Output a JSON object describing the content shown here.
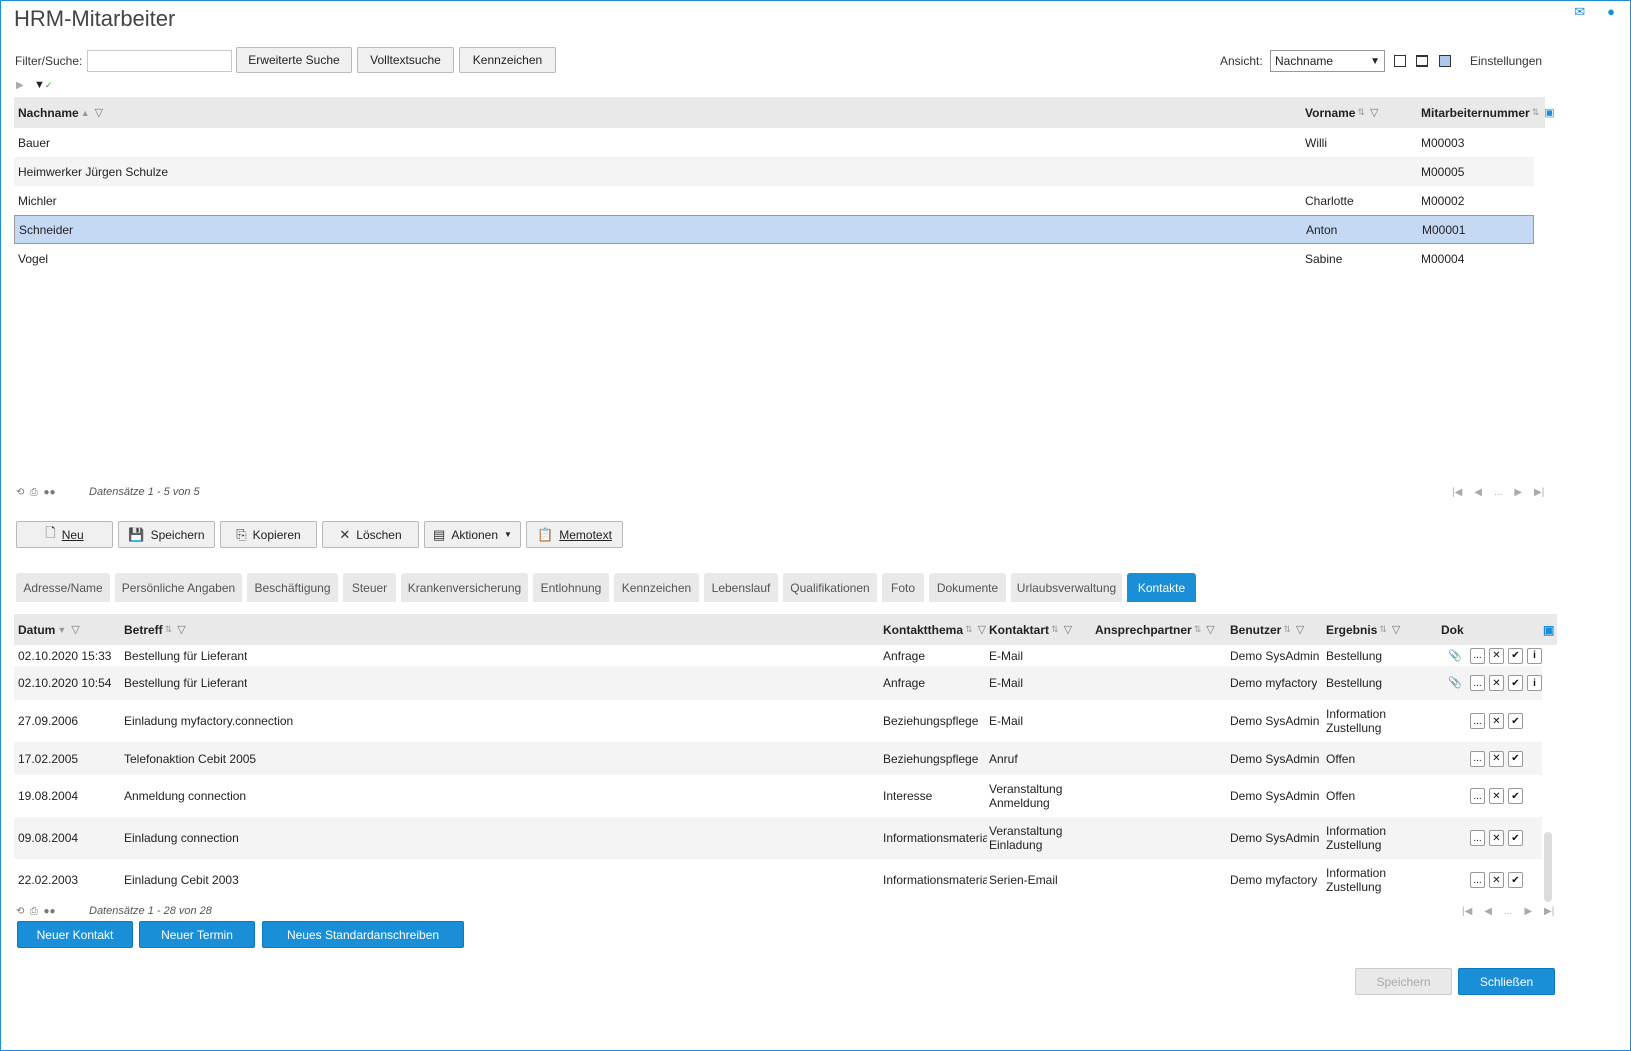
{
  "header": {
    "title": "HRM-Mitarbeiter",
    "mail_icon": "mail-icon",
    "help_icon": "help-icon"
  },
  "search": {
    "label": "Filter/Suche:",
    "value": "",
    "advanced": "Erweiterte Suche",
    "fulltext": "Volltextsuche",
    "flags": "Kennzeichen"
  },
  "view": {
    "label": "Ansicht:",
    "selected": "Nachname",
    "settings": "Einstellungen"
  },
  "grid": {
    "columns": [
      "Nachname",
      "Vorname",
      "Mitarbeiternummer"
    ],
    "rows": [
      {
        "nachname": "Bauer",
        "vorname": "Willi",
        "nummer": "M00003"
      },
      {
        "nachname": "Heimwerker Jürgen Schulze",
        "vorname": "",
        "nummer": "M00005"
      },
      {
        "nachname": "Michler",
        "vorname": "Charlotte",
        "nummer": "M00002"
      },
      {
        "nachname": "Schneider",
        "vorname": "Anton",
        "nummer": "M00001"
      },
      {
        "nachname": "Vogel",
        "vorname": "Sabine",
        "nummer": "M00004"
      }
    ],
    "selected_row": 3,
    "footer": "Datensätze 1 - 5 von 5"
  },
  "toolbar": {
    "neu": "Neu",
    "speichern": "Speichern",
    "kopieren": "Kopieren",
    "loeschen": "Löschen",
    "aktionen": "Aktionen",
    "memotext": "Memotext"
  },
  "tabs": [
    "Adresse/Name",
    "Persönliche Angaben",
    "Beschäftigung",
    "Steuer",
    "Krankenversicherung",
    "Entlohnung",
    "Kennzeichen",
    "Lebenslauf",
    "Qualifikationen",
    "Foto",
    "Dokumente",
    "Urlaubsverwaltung",
    "Kontakte"
  ],
  "active_tab": "Kontakte",
  "contacts": {
    "columns": {
      "datum": "Datum",
      "betreff": "Betreff",
      "thema": "Kontaktthema",
      "art": "Kontaktart",
      "partner": "Ansprechpartner",
      "benutzer": "Benutzer",
      "ergebnis": "Ergebnis",
      "dok": "Dok"
    },
    "rows": [
      {
        "datum": "02.10.2020 15:33",
        "betreff": "Bestellung für Lieferant",
        "thema": "Anfrage",
        "art": "E-Mail",
        "art2": "",
        "benutzer": "Demo SysAdmin",
        "ergebnis": "Bestellung",
        "ergebnis2": "",
        "attach": true,
        "info": true
      },
      {
        "datum": "02.10.2020 10:54",
        "betreff": "Bestellung für Lieferant",
        "thema": "Anfrage",
        "art": "E-Mail",
        "art2": "",
        "benutzer": "Demo myfactory",
        "ergebnis": "Bestellung",
        "ergebnis2": "",
        "attach": true,
        "info": true
      },
      {
        "datum": "27.09.2006",
        "betreff": "Einladung myfactory.connection",
        "thema": "Beziehungspflege",
        "art": "E-Mail",
        "art2": "",
        "benutzer": "Demo SysAdmin",
        "ergebnis": "Information",
        "ergebnis2": "Zustellung",
        "attach": false,
        "info": false
      },
      {
        "datum": "17.02.2005",
        "betreff": "Telefonaktion Cebit 2005",
        "thema": "Beziehungspflege",
        "art": "Anruf",
        "art2": "",
        "benutzer": "Demo SysAdmin",
        "ergebnis": "Offen",
        "ergebnis2": "",
        "attach": false,
        "info": false
      },
      {
        "datum": "19.08.2004",
        "betreff": "Anmeldung connection",
        "thema": "Interesse",
        "art": "Veranstaltung",
        "art2": "Anmeldung",
        "benutzer": "Demo SysAdmin",
        "ergebnis": "Offen",
        "ergebnis2": "",
        "attach": false,
        "info": false
      },
      {
        "datum": "09.08.2004",
        "betreff": "Einladung connection",
        "thema": "Informationsmateria",
        "art": "Veranstaltung",
        "art2": "Einladung",
        "benutzer": "Demo SysAdmin",
        "ergebnis": "Information",
        "ergebnis2": "Zustellung",
        "attach": false,
        "info": false
      },
      {
        "datum": "22.02.2003",
        "betreff": "Einladung Cebit 2003",
        "thema": "Informationsmateria",
        "art": "Serien-Email",
        "art2": "",
        "benutzer": "Demo myfactory",
        "ergebnis": "Information",
        "ergebnis2": "Zustellung",
        "attach": false,
        "info": false
      }
    ],
    "footer": "Datensätze 1 - 28 von 28"
  },
  "actions": {
    "neuer_kontakt": "Neuer Kontakt",
    "neuer_termin": "Neuer Termin",
    "standardanschreiben": "Neues Standardanschreiben"
  },
  "bottom": {
    "speichern": "Speichern",
    "schliessen": "Schließen"
  },
  "colors": {
    "accent": "#1a8fd8",
    "selected_row": "#c5d9f4"
  }
}
